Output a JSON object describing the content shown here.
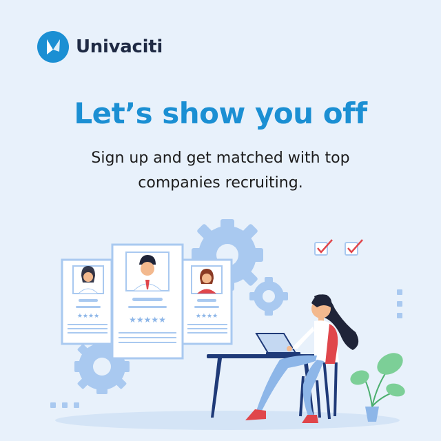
{
  "brand": {
    "name": "Univaciti",
    "logo_icon": "univaciti-logo-icon",
    "color": "#1b8fd3"
  },
  "hero": {
    "headline": "Let’s show you off",
    "subline_1": "Sign up and get matched with top",
    "subline_2": "companies recruiting."
  },
  "colors": {
    "background": "#e8f1fb",
    "accent": "#1b8fd3",
    "text": "#1c1c1c",
    "illustration_blue": "#a9c9f0",
    "checkmark": "#e0464b"
  }
}
